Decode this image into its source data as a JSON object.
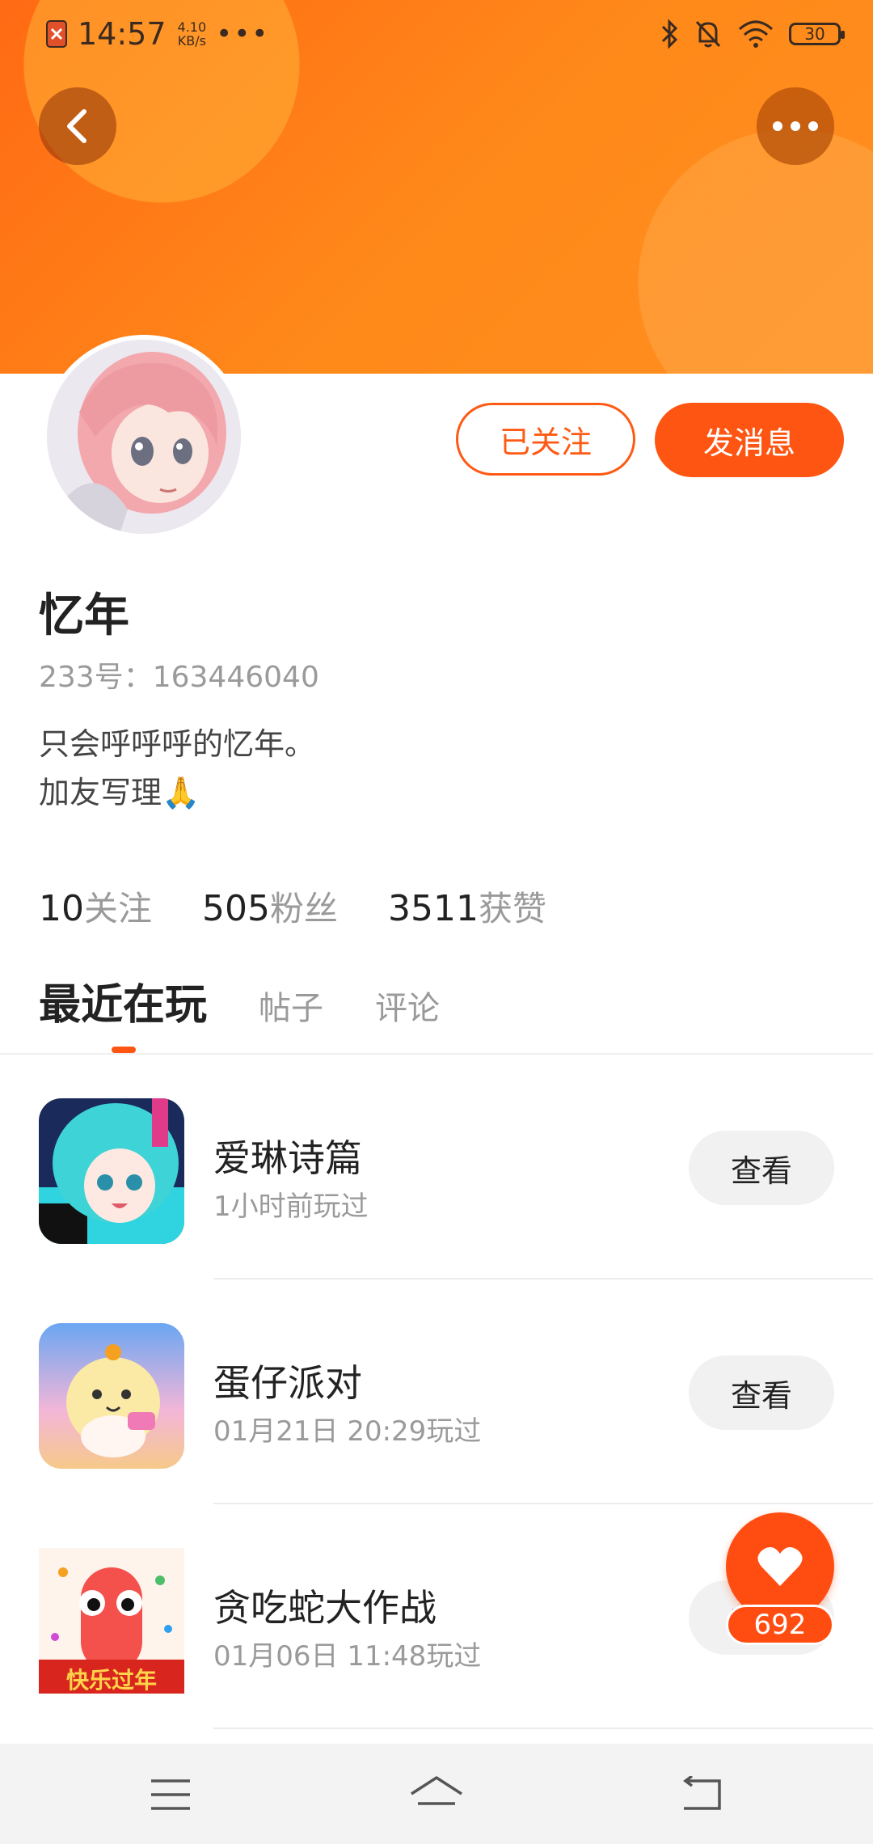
{
  "status_bar": {
    "time": "14:57",
    "speed_value": "4.10",
    "speed_unit": "KB/s",
    "more_dots": "•••",
    "battery": "30"
  },
  "profile": {
    "name": "忆年",
    "id_text": "233号：163446040",
    "bio_line1": "只会呼呼呼的忆年。",
    "bio_line2": "加友写理🙏",
    "follow_button": "已关注",
    "message_button": "发消息"
  },
  "stats": [
    {
      "value": "10",
      "label": "关注"
    },
    {
      "value": "505",
      "label": "粉丝"
    },
    {
      "value": "3511",
      "label": "获赞"
    }
  ],
  "tabs": [
    {
      "label": "最近在玩",
      "active": true
    },
    {
      "label": "帖子",
      "active": false
    },
    {
      "label": "评论",
      "active": false
    }
  ],
  "games": [
    {
      "name": "爱琳诗篇",
      "played": "1小时前玩过",
      "button": "查看"
    },
    {
      "name": "蛋仔派对",
      "played": "01月21日 20:29玩过",
      "button": "查看"
    },
    {
      "name": "贪吃蛇大作战",
      "played": "01月06日 11:48玩过",
      "button": "查看",
      "icon_text": "快乐过年"
    }
  ],
  "like": {
    "count": "692"
  },
  "colors": {
    "accent": "#ff5512",
    "header_orange": "#ff7a16"
  }
}
